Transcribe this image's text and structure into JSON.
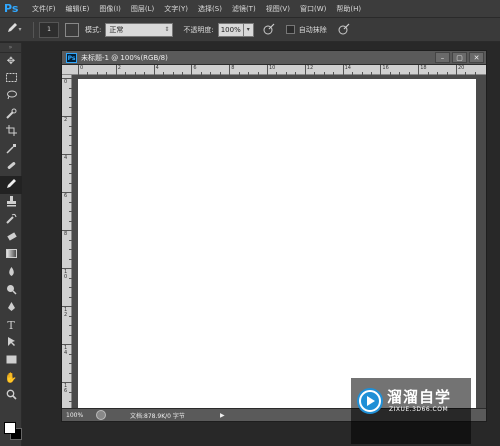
{
  "app": {
    "logo_text": "Ps"
  },
  "menu": {
    "items": [
      {
        "label": "文件(F)"
      },
      {
        "label": "编辑(E)"
      },
      {
        "label": "图像(I)"
      },
      {
        "label": "图层(L)"
      },
      {
        "label": "文字(Y)"
      },
      {
        "label": "选择(S)"
      },
      {
        "label": "滤镜(T)"
      },
      {
        "label": "视图(V)"
      },
      {
        "label": "窗口(W)"
      },
      {
        "label": "帮助(H)"
      }
    ]
  },
  "options_bar": {
    "brush_size": "1",
    "mode_label": "模式:",
    "mode_value": "正常",
    "opacity_label": "不透明度:",
    "opacity_value": "100%",
    "auto_erase_label": "自动抹除",
    "auto_erase_checked": false
  },
  "toolbar": {
    "tools": [
      {
        "name": "move-tool",
        "icon": "move-icon"
      },
      {
        "name": "marquee-tool",
        "icon": "marquee-icon"
      },
      {
        "name": "lasso-tool",
        "icon": "lasso-icon"
      },
      {
        "name": "quick-selection-tool",
        "icon": "quick-selection-icon"
      },
      {
        "name": "crop-tool",
        "icon": "crop-icon"
      },
      {
        "name": "eyedropper-tool",
        "icon": "eyedropper-icon"
      },
      {
        "name": "healing-brush-tool",
        "icon": "healing-icon"
      },
      {
        "name": "pencil-tool",
        "icon": "pencil-icon",
        "active": true
      },
      {
        "name": "clone-stamp-tool",
        "icon": "stamp-icon"
      },
      {
        "name": "history-brush-tool",
        "icon": "history-brush-icon"
      },
      {
        "name": "eraser-tool",
        "icon": "eraser-icon"
      },
      {
        "name": "gradient-tool",
        "icon": "gradient-icon"
      },
      {
        "name": "blur-tool",
        "icon": "blur-icon"
      },
      {
        "name": "dodge-tool",
        "icon": "dodge-icon"
      },
      {
        "name": "pen-tool",
        "icon": "pen-icon"
      },
      {
        "name": "type-tool",
        "icon": "type-icon"
      },
      {
        "name": "path-selection-tool",
        "icon": "path-selection-icon"
      },
      {
        "name": "rectangle-tool",
        "icon": "rectangle-icon"
      },
      {
        "name": "hand-tool",
        "icon": "hand-icon"
      },
      {
        "name": "zoom-tool",
        "icon": "zoom-icon"
      }
    ],
    "foreground_color": "#ffffff",
    "background_color": "#000000"
  },
  "document": {
    "title": "未标题-1 @ 100%(RGB/8)",
    "icon_text": "Ps",
    "zoom": "100%",
    "doc_size": "文档:878.9K/0 字节",
    "ruler_top_labels": [
      "0",
      "2",
      "4",
      "6",
      "8",
      "10",
      "12",
      "14",
      "16",
      "18",
      "20"
    ],
    "ruler_left_labels": [
      "0",
      "2",
      "4",
      "6",
      "8",
      "10",
      "12",
      "14",
      "16"
    ]
  },
  "watermark": {
    "title": "溜溜自学",
    "url": "ZIXUE.3D66.COM"
  }
}
